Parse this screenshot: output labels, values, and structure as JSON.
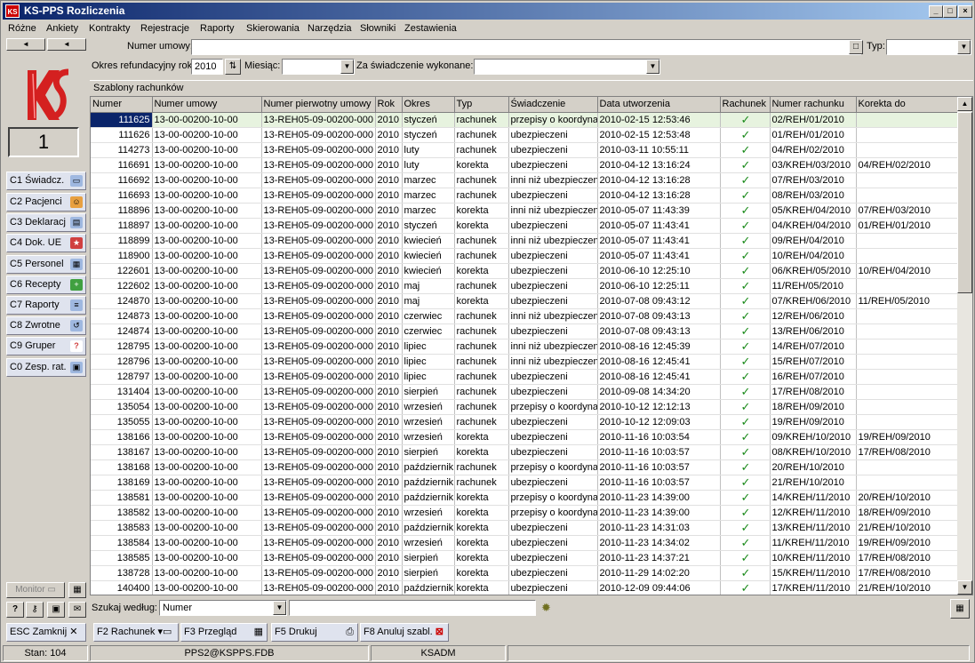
{
  "window": {
    "title": "KS-PPS Rozliczenia",
    "logo_text": "KS"
  },
  "menu": [
    "Różne",
    "Ankiety",
    "Kontrakty",
    "Rejestracje",
    "Raporty",
    "Skierowania",
    "Narzędzia",
    "Słowniki",
    "Zestawienia"
  ],
  "sidebar": {
    "counter": "1",
    "buttons": [
      {
        "label": "C1 Świadcz.",
        "icon": "document-icon",
        "color": "#9fb8e0"
      },
      {
        "label": "C2 Pacjenci",
        "icon": "people-icon",
        "color": "#e8a040"
      },
      {
        "label": "C3 Deklaracj",
        "icon": "papers-icon",
        "color": "#9fb8e0"
      },
      {
        "label": "C4 Dok. UE",
        "icon": "eu-document-icon",
        "color": "#d04040"
      },
      {
        "label": "C5 Personel",
        "icon": "personnel-icon",
        "color": "#9fb8e0"
      },
      {
        "label": "C6 Recepty",
        "icon": "prescription-icon",
        "color": "#40a040"
      },
      {
        "label": "C7 Raporty",
        "icon": "report-icon",
        "color": "#9fb8e0"
      },
      {
        "label": "C8 Zwrotne",
        "icon": "return-icon",
        "color": "#9fb8e0"
      },
      {
        "label": "C9 Gruper",
        "icon": "question-icon",
        "color": "#d04040"
      },
      {
        "label": "C0 Zesp. rat.",
        "icon": "ambulance-icon",
        "color": "#9fb8e0"
      }
    ],
    "monitor_label": "Monitor"
  },
  "form": {
    "numer_umowy_label": "Numer umowy:",
    "numer_umowy_value": "",
    "typ_label": "Typ:",
    "typ_value": "",
    "okres_label": "Okres refundacyjny rok:",
    "rok_value": "2010",
    "miesiac_label": "Miesiąc:",
    "miesiac_value": "",
    "swiadczenie_label": "Za świadczenie wykonane:",
    "swiadczenie_value": ""
  },
  "grid": {
    "section_title": "Szablony rachunków",
    "columns": [
      "Numer",
      "Numer umowy",
      "Numer pierwotny umowy",
      "Rok",
      "Okres",
      "Typ",
      "Świadczenie",
      "Data utworzenia",
      "Rachunek",
      "Numer rachunku",
      "Korekta do"
    ],
    "check_glyph": "✓",
    "rows": [
      [
        "111625",
        "13-00-00200-10-00",
        "13-REH05-09-00200-000",
        "2010",
        "styczeń",
        "rachunek",
        "przepisy o koordynac",
        "2010-02-15 12:53:46",
        "✓",
        "02/REH/01/2010",
        ""
      ],
      [
        "111626",
        "13-00-00200-10-00",
        "13-REH05-09-00200-000",
        "2010",
        "styczeń",
        "rachunek",
        "ubezpieczeni",
        "2010-02-15 12:53:48",
        "✓",
        "01/REH/01/2010",
        ""
      ],
      [
        "114273",
        "13-00-00200-10-00",
        "13-REH05-09-00200-000",
        "2010",
        "luty",
        "rachunek",
        "ubezpieczeni",
        "2010-03-11 10:55:11",
        "✓",
        "04/REH/02/2010",
        ""
      ],
      [
        "116691",
        "13-00-00200-10-00",
        "13-REH05-09-00200-000",
        "2010",
        "luty",
        "korekta",
        "ubezpieczeni",
        "2010-04-12 13:16:24",
        "✓",
        "03/KREH/03/2010",
        "04/REH/02/2010"
      ],
      [
        "116692",
        "13-00-00200-10-00",
        "13-REH05-09-00200-000",
        "2010",
        "marzec",
        "rachunek",
        "inni niż ubezpieczeni",
        "2010-04-12 13:16:28",
        "✓",
        "07/REH/03/2010",
        ""
      ],
      [
        "116693",
        "13-00-00200-10-00",
        "13-REH05-09-00200-000",
        "2010",
        "marzec",
        "rachunek",
        "ubezpieczeni",
        "2010-04-12 13:16:28",
        "✓",
        "08/REH/03/2010",
        ""
      ],
      [
        "118896",
        "13-00-00200-10-00",
        "13-REH05-09-00200-000",
        "2010",
        "marzec",
        "korekta",
        "inni niż ubezpieczeni",
        "2010-05-07 11:43:39",
        "✓",
        "05/KREH/04/2010",
        "07/REH/03/2010"
      ],
      [
        "118897",
        "13-00-00200-10-00",
        "13-REH05-09-00200-000",
        "2010",
        "styczeń",
        "korekta",
        "ubezpieczeni",
        "2010-05-07 11:43:41",
        "✓",
        "04/KREH/04/2010",
        "01/REH/01/2010"
      ],
      [
        "118899",
        "13-00-00200-10-00",
        "13-REH05-09-00200-000",
        "2010",
        "kwiecień",
        "rachunek",
        "inni niż ubezpieczeni",
        "2010-05-07 11:43:41",
        "✓",
        "09/REH/04/2010",
        ""
      ],
      [
        "118900",
        "13-00-00200-10-00",
        "13-REH05-09-00200-000",
        "2010",
        "kwiecień",
        "rachunek",
        "ubezpieczeni",
        "2010-05-07 11:43:41",
        "✓",
        "10/REH/04/2010",
        ""
      ],
      [
        "122601",
        "13-00-00200-10-00",
        "13-REH05-09-00200-000",
        "2010",
        "kwiecień",
        "korekta",
        "ubezpieczeni",
        "2010-06-10 12:25:10",
        "✓",
        "06/KREH/05/2010",
        "10/REH/04/2010"
      ],
      [
        "122602",
        "13-00-00200-10-00",
        "13-REH05-09-00200-000",
        "2010",
        "maj",
        "rachunek",
        "ubezpieczeni",
        "2010-06-10 12:25:11",
        "✓",
        "11/REH/05/2010",
        ""
      ],
      [
        "124870",
        "13-00-00200-10-00",
        "13-REH05-09-00200-000",
        "2010",
        "maj",
        "korekta",
        "ubezpieczeni",
        "2010-07-08 09:43:12",
        "✓",
        "07/KREH/06/2010",
        "11/REH/05/2010"
      ],
      [
        "124873",
        "13-00-00200-10-00",
        "13-REH05-09-00200-000",
        "2010",
        "czerwiec",
        "rachunek",
        "inni niż ubezpieczeni",
        "2010-07-08 09:43:13",
        "✓",
        "12/REH/06/2010",
        ""
      ],
      [
        "124874",
        "13-00-00200-10-00",
        "13-REH05-09-00200-000",
        "2010",
        "czerwiec",
        "rachunek",
        "ubezpieczeni",
        "2010-07-08 09:43:13",
        "✓",
        "13/REH/06/2010",
        ""
      ],
      [
        "128795",
        "13-00-00200-10-00",
        "13-REH05-09-00200-000",
        "2010",
        "lipiec",
        "rachunek",
        "inni niż ubezpieczeni",
        "2010-08-16 12:45:39",
        "✓",
        "14/REH/07/2010",
        ""
      ],
      [
        "128796",
        "13-00-00200-10-00",
        "13-REH05-09-00200-000",
        "2010",
        "lipiec",
        "rachunek",
        "inni niż ubezpieczeni",
        "2010-08-16 12:45:41",
        "✓",
        "15/REH/07/2010",
        ""
      ],
      [
        "128797",
        "13-00-00200-10-00",
        "13-REH05-09-00200-000",
        "2010",
        "lipiec",
        "rachunek",
        "ubezpieczeni",
        "2010-08-16 12:45:41",
        "✓",
        "16/REH/07/2010",
        ""
      ],
      [
        "131404",
        "13-00-00200-10-00",
        "13-REH05-09-00200-000",
        "2010",
        "sierpień",
        "rachunek",
        "ubezpieczeni",
        "2010-09-08 14:34:20",
        "✓",
        "17/REH/08/2010",
        ""
      ],
      [
        "135054",
        "13-00-00200-10-00",
        "13-REH05-09-00200-000",
        "2010",
        "wrzesień",
        "rachunek",
        "przepisy o koordynac",
        "2010-10-12 12:12:13",
        "✓",
        "18/REH/09/2010",
        ""
      ],
      [
        "135055",
        "13-00-00200-10-00",
        "13-REH05-09-00200-000",
        "2010",
        "wrzesień",
        "rachunek",
        "ubezpieczeni",
        "2010-10-12 12:09:03",
        "✓",
        "19/REH/09/2010",
        ""
      ],
      [
        "138166",
        "13-00-00200-10-00",
        "13-REH05-09-00200-000",
        "2010",
        "wrzesień",
        "korekta",
        "ubezpieczeni",
        "2010-11-16 10:03:54",
        "✓",
        "09/KREH/10/2010",
        "19/REH/09/2010"
      ],
      [
        "138167",
        "13-00-00200-10-00",
        "13-REH05-09-00200-000",
        "2010",
        "sierpień",
        "korekta",
        "ubezpieczeni",
        "2010-11-16 10:03:57",
        "✓",
        "08/KREH/10/2010",
        "17/REH/08/2010"
      ],
      [
        "138168",
        "13-00-00200-10-00",
        "13-REH05-09-00200-000",
        "2010",
        "październik",
        "rachunek",
        "przepisy o koordynac",
        "2010-11-16 10:03:57",
        "✓",
        "20/REH/10/2010",
        ""
      ],
      [
        "138169",
        "13-00-00200-10-00",
        "13-REH05-09-00200-000",
        "2010",
        "październik",
        "rachunek",
        "ubezpieczeni",
        "2010-11-16 10:03:57",
        "✓",
        "21/REH/10/2010",
        ""
      ],
      [
        "138581",
        "13-00-00200-10-00",
        "13-REH05-09-00200-000",
        "2010",
        "październik",
        "korekta",
        "przepisy o koordynac",
        "2010-11-23 14:39:00",
        "✓",
        "14/KREH/11/2010",
        "20/REH/10/2010"
      ],
      [
        "138582",
        "13-00-00200-10-00",
        "13-REH05-09-00200-000",
        "2010",
        "wrzesień",
        "korekta",
        "przepisy o koordynac",
        "2010-11-23 14:39:00",
        "✓",
        "12/KREH/11/2010",
        "18/REH/09/2010"
      ],
      [
        "138583",
        "13-00-00200-10-00",
        "13-REH05-09-00200-000",
        "2010",
        "październik",
        "korekta",
        "ubezpieczeni",
        "2010-11-23 14:31:03",
        "✓",
        "13/KREH/11/2010",
        "21/REH/10/2010"
      ],
      [
        "138584",
        "13-00-00200-10-00",
        "13-REH05-09-00200-000",
        "2010",
        "wrzesień",
        "korekta",
        "ubezpieczeni",
        "2010-11-23 14:34:02",
        "✓",
        "11/KREH/11/2010",
        "19/REH/09/2010"
      ],
      [
        "138585",
        "13-00-00200-10-00",
        "13-REH05-09-00200-000",
        "2010",
        "sierpień",
        "korekta",
        "ubezpieczeni",
        "2010-11-23 14:37:21",
        "✓",
        "10/KREH/11/2010",
        "17/REH/08/2010"
      ],
      [
        "138728",
        "13-00-00200-10-00",
        "13-REH05-09-00200-000",
        "2010",
        "sierpień",
        "korekta",
        "ubezpieczeni",
        "2010-11-29 14:02:20",
        "✓",
        "15/KREH/11/2010",
        "17/REH/08/2010"
      ],
      [
        "140400",
        "13-00-00200-10-00",
        "13-REH05-09-00200-000",
        "2010",
        "październik",
        "korekta",
        "ubezpieczeni",
        "2010-12-09 09:44:06",
        "✓",
        "17/KREH/11/2010",
        "21/REH/10/2010"
      ]
    ]
  },
  "search": {
    "label": "Szukaj według:",
    "field_value": "Numer",
    "query_value": ""
  },
  "buttons": {
    "esc": "ESC Zamknij",
    "f2": "F2 Rachunek",
    "f3": "F3 Przegląd",
    "f5": "F5 Drukuj",
    "f8": "F8 Anuluj szabl."
  },
  "status": {
    "count": "Stan: 104",
    "database": "PPS2@KSPPS.FDB",
    "user": "KSADM"
  }
}
